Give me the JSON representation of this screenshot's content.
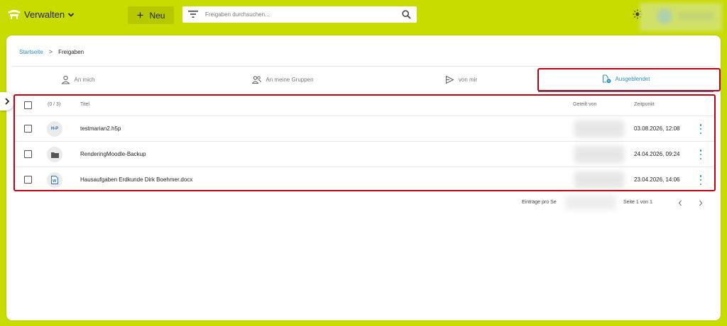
{
  "header": {
    "manage_label": "Verwalten",
    "new_label": "Neu",
    "search_placeholder": "Freigaben durchsuchen..."
  },
  "breadcrumb": {
    "home": "Startseite",
    "current": "Freigaben"
  },
  "tabs": [
    {
      "label": "An mich",
      "icon": "person-icon",
      "active": false
    },
    {
      "label": "An meine Gruppen",
      "icon": "group-icon",
      "active": false
    },
    {
      "label": "von mir",
      "icon": "send-icon",
      "active": false
    },
    {
      "label": "Ausgeblendet",
      "icon": "hidden-file-icon",
      "active": true
    }
  ],
  "table": {
    "selection_count": "(0 / 3)",
    "columns": {
      "title": "Titel",
      "shared_by": "Geteilt von",
      "time": "Zeitpunkt"
    },
    "rows": [
      {
        "icon": "h5p-icon",
        "icon_text": "H-P",
        "title": "testmarian2.h5p",
        "time": "03.08.2026, 12:08"
      },
      {
        "icon": "folder-icon",
        "title": "RenderingMoodle-Backup",
        "time": "24.04.2026, 09:24"
      },
      {
        "icon": "word-doc-icon",
        "title": "Hausaufgaben Erdkunde Dirk Boehmer.docx",
        "time": "23.04.2026, 14:06"
      }
    ]
  },
  "pagination": {
    "per_page_label": "Einträge pro Se",
    "page_info": "Seite 1 von 1"
  },
  "colors": {
    "brand": "#c8dc00",
    "accent": "#2b8fbe",
    "highlight": "#c00010"
  }
}
